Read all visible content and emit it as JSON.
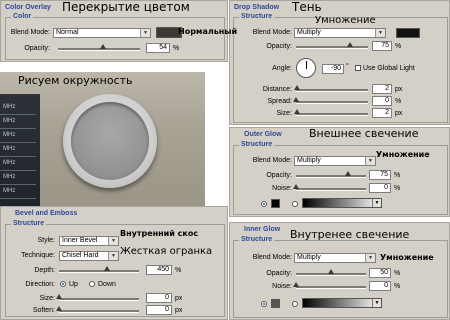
{
  "color_overlay": {
    "title": "Color Overlay",
    "section": "Color",
    "blend_label": "Blend Mode:",
    "blend_value": "Normal",
    "opacity_label": "Opacity:",
    "opacity_value": "54",
    "unit": "%",
    "swatch_color": "#3d3a36",
    "opacity_level": 0.54
  },
  "drop_shadow": {
    "title": "Drop Shadow",
    "section": "Structure",
    "blend_label": "Blend Mode:",
    "blend_value": "Multiply",
    "opacity_label": "Opacity:",
    "opacity_value": "75",
    "angle_label": "Angle:",
    "angle_value": "-90",
    "global_light": "Use Global Light",
    "distance_label": "Distance:",
    "distance_value": "2",
    "spread_label": "Spread:",
    "spread_value": "0",
    "size_label": "Size:",
    "size_value": "2",
    "px": "px",
    "pct": "%",
    "swatch_color": "#111111"
  },
  "outer_glow": {
    "title": "Outer Glow",
    "section": "Structure",
    "blend_label": "Blend Mode:",
    "blend_value": "Multiply",
    "opacity_label": "Opacity:",
    "opacity_value": "75",
    "noise_label": "Noise:",
    "noise_value": "0",
    "pct": "%",
    "swatch_color": "#000000"
  },
  "inner_glow": {
    "title": "Inner Glow",
    "section": "Structure",
    "blend_label": "Blend Mode:",
    "blend_value": "Multiply",
    "opacity_label": "Opacity:",
    "opacity_value": "50",
    "noise_label": "Noise:",
    "noise_value": "0",
    "pct": "%",
    "swatch_color": "#555555"
  },
  "bevel": {
    "title": "Bevel and Emboss",
    "section": "Structure",
    "style_label": "Style:",
    "style_value": "Inner Bevel",
    "technique_label": "Technique:",
    "technique_value": "Chisel Hard",
    "depth_label": "Depth:",
    "depth_value": "450",
    "direction_label": "Direction:",
    "dir_up": "Up",
    "dir_down": "Down",
    "size_label": "Size:",
    "size_value": "0",
    "soften_label": "Soften:",
    "soften_value": "0",
    "pct": "%",
    "px": "px"
  },
  "annotations": {
    "color_overlay": "Перекрытие цветом",
    "normal": "Нормальный",
    "shadow": "Тень",
    "multiply_1": "Умножение",
    "circle": "Рисуем окружность",
    "outer_glow": "Внешнее свечение",
    "multiply_2": "Умножение",
    "inner_bevel": "Внутренний скос",
    "chisel": "Жесткая огранка",
    "inner_glow": "Внутренее свечение",
    "multiply_3": "Умножение"
  },
  "device": {
    "lcd_labels": [
      "MHz",
      "MHz",
      "MHz",
      "MHz",
      "MHz",
      "MHz",
      "MHz"
    ]
  },
  "colors": {
    "panel_bg": "#d4d0c8",
    "title_blue": "#2b4a9a"
  }
}
